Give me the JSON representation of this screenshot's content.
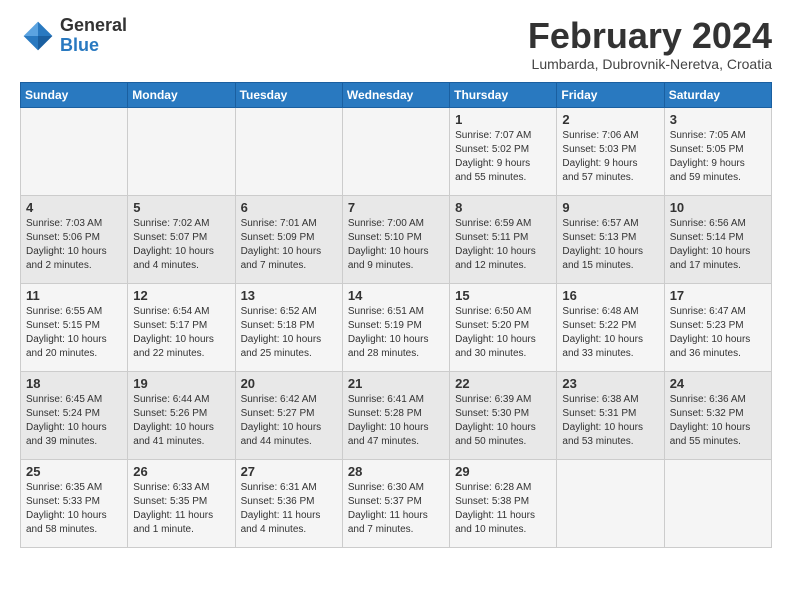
{
  "header": {
    "logo_general": "General",
    "logo_blue": "Blue",
    "month_year": "February 2024",
    "location": "Lumbarda, Dubrovnik-Neretva, Croatia"
  },
  "days_of_week": [
    "Sunday",
    "Monday",
    "Tuesday",
    "Wednesday",
    "Thursday",
    "Friday",
    "Saturday"
  ],
  "weeks": [
    [
      {
        "day": "",
        "info": ""
      },
      {
        "day": "",
        "info": ""
      },
      {
        "day": "",
        "info": ""
      },
      {
        "day": "",
        "info": ""
      },
      {
        "day": "1",
        "info": "Sunrise: 7:07 AM\nSunset: 5:02 PM\nDaylight: 9 hours\nand 55 minutes."
      },
      {
        "day": "2",
        "info": "Sunrise: 7:06 AM\nSunset: 5:03 PM\nDaylight: 9 hours\nand 57 minutes."
      },
      {
        "day": "3",
        "info": "Sunrise: 7:05 AM\nSunset: 5:05 PM\nDaylight: 9 hours\nand 59 minutes."
      }
    ],
    [
      {
        "day": "4",
        "info": "Sunrise: 7:03 AM\nSunset: 5:06 PM\nDaylight: 10 hours\nand 2 minutes."
      },
      {
        "day": "5",
        "info": "Sunrise: 7:02 AM\nSunset: 5:07 PM\nDaylight: 10 hours\nand 4 minutes."
      },
      {
        "day": "6",
        "info": "Sunrise: 7:01 AM\nSunset: 5:09 PM\nDaylight: 10 hours\nand 7 minutes."
      },
      {
        "day": "7",
        "info": "Sunrise: 7:00 AM\nSunset: 5:10 PM\nDaylight: 10 hours\nand 9 minutes."
      },
      {
        "day": "8",
        "info": "Sunrise: 6:59 AM\nSunset: 5:11 PM\nDaylight: 10 hours\nand 12 minutes."
      },
      {
        "day": "9",
        "info": "Sunrise: 6:57 AM\nSunset: 5:13 PM\nDaylight: 10 hours\nand 15 minutes."
      },
      {
        "day": "10",
        "info": "Sunrise: 6:56 AM\nSunset: 5:14 PM\nDaylight: 10 hours\nand 17 minutes."
      }
    ],
    [
      {
        "day": "11",
        "info": "Sunrise: 6:55 AM\nSunset: 5:15 PM\nDaylight: 10 hours\nand 20 minutes."
      },
      {
        "day": "12",
        "info": "Sunrise: 6:54 AM\nSunset: 5:17 PM\nDaylight: 10 hours\nand 22 minutes."
      },
      {
        "day": "13",
        "info": "Sunrise: 6:52 AM\nSunset: 5:18 PM\nDaylight: 10 hours\nand 25 minutes."
      },
      {
        "day": "14",
        "info": "Sunrise: 6:51 AM\nSunset: 5:19 PM\nDaylight: 10 hours\nand 28 minutes."
      },
      {
        "day": "15",
        "info": "Sunrise: 6:50 AM\nSunset: 5:20 PM\nDaylight: 10 hours\nand 30 minutes."
      },
      {
        "day": "16",
        "info": "Sunrise: 6:48 AM\nSunset: 5:22 PM\nDaylight: 10 hours\nand 33 minutes."
      },
      {
        "day": "17",
        "info": "Sunrise: 6:47 AM\nSunset: 5:23 PM\nDaylight: 10 hours\nand 36 minutes."
      }
    ],
    [
      {
        "day": "18",
        "info": "Sunrise: 6:45 AM\nSunset: 5:24 PM\nDaylight: 10 hours\nand 39 minutes."
      },
      {
        "day": "19",
        "info": "Sunrise: 6:44 AM\nSunset: 5:26 PM\nDaylight: 10 hours\nand 41 minutes."
      },
      {
        "day": "20",
        "info": "Sunrise: 6:42 AM\nSunset: 5:27 PM\nDaylight: 10 hours\nand 44 minutes."
      },
      {
        "day": "21",
        "info": "Sunrise: 6:41 AM\nSunset: 5:28 PM\nDaylight: 10 hours\nand 47 minutes."
      },
      {
        "day": "22",
        "info": "Sunrise: 6:39 AM\nSunset: 5:30 PM\nDaylight: 10 hours\nand 50 minutes."
      },
      {
        "day": "23",
        "info": "Sunrise: 6:38 AM\nSunset: 5:31 PM\nDaylight: 10 hours\nand 53 minutes."
      },
      {
        "day": "24",
        "info": "Sunrise: 6:36 AM\nSunset: 5:32 PM\nDaylight: 10 hours\nand 55 minutes."
      }
    ],
    [
      {
        "day": "25",
        "info": "Sunrise: 6:35 AM\nSunset: 5:33 PM\nDaylight: 10 hours\nand 58 minutes."
      },
      {
        "day": "26",
        "info": "Sunrise: 6:33 AM\nSunset: 5:35 PM\nDaylight: 11 hours\nand 1 minute."
      },
      {
        "day": "27",
        "info": "Sunrise: 6:31 AM\nSunset: 5:36 PM\nDaylight: 11 hours\nand 4 minutes."
      },
      {
        "day": "28",
        "info": "Sunrise: 6:30 AM\nSunset: 5:37 PM\nDaylight: 11 hours\nand 7 minutes."
      },
      {
        "day": "29",
        "info": "Sunrise: 6:28 AM\nSunset: 5:38 PM\nDaylight: 11 hours\nand 10 minutes."
      },
      {
        "day": "",
        "info": ""
      },
      {
        "day": "",
        "info": ""
      }
    ]
  ]
}
